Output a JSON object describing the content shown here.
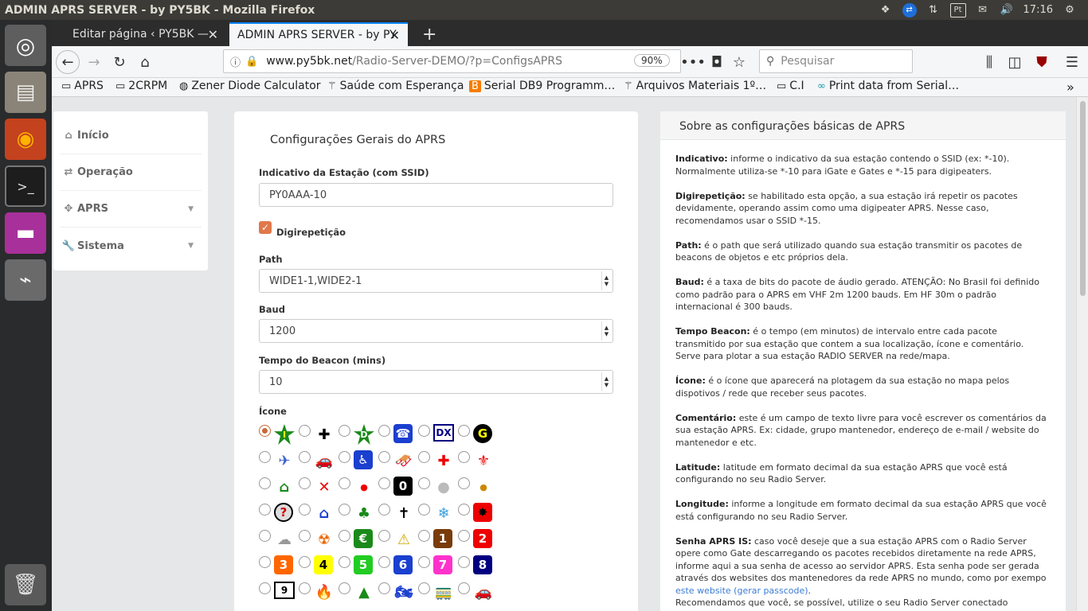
{
  "window": {
    "title": "ADMIN APRS SERVER - by PY5BK - Mozilla Firefox",
    "clock": "17:16",
    "tray_box_label": "Pt"
  },
  "tabs": [
    {
      "label": "Editar página ‹ PY5BK —",
      "close": "✕"
    },
    {
      "label": "ADMIN APRS SERVER - by PY",
      "close": "✕"
    }
  ],
  "new_tab": "+",
  "urlbar": {
    "domain": "www.py5bk.net",
    "path": "/Radio-Server-DEMO/?p=ConfigsAPRS",
    "zoom": "90%"
  },
  "search": {
    "placeholder": "Pesquisar"
  },
  "bookmarks": [
    {
      "icon": "folder-icon",
      "glyph": "▭",
      "label": "APRS"
    },
    {
      "icon": "folder-icon",
      "glyph": "▭",
      "label": "2CRPM"
    },
    {
      "icon": "globe-icon",
      "glyph": "◍",
      "label": "Zener Diode Calculator"
    },
    {
      "icon": "site-icon",
      "glyph": "⚚",
      "label": "Saúde com Esperança"
    },
    {
      "icon": "blogger-icon",
      "glyph": "B",
      "label": "Serial DB9 Programm…"
    },
    {
      "icon": "site-icon",
      "glyph": "⚚",
      "label": "Arquivos Materiais 1º…"
    },
    {
      "icon": "folder-icon",
      "glyph": "▭",
      "label": "C.I"
    },
    {
      "icon": "link-icon",
      "glyph": "∞",
      "label": "Print data from Serial…"
    }
  ],
  "sidebar": {
    "items": [
      {
        "icon": "home-icon",
        "glyph": "⌂",
        "label": "Início",
        "caret": ""
      },
      {
        "icon": "shuffle-icon",
        "glyph": "⇄",
        "label": "Operação",
        "caret": ""
      },
      {
        "icon": "crosshair-icon",
        "glyph": "✥",
        "label": "APRS",
        "caret": "▼"
      },
      {
        "icon": "wrench-icon",
        "glyph": "🔧",
        "label": "Sistema",
        "caret": "▼"
      }
    ]
  },
  "form": {
    "title": "Configurações Gerais do APRS",
    "callsign_label": "Indicativo da Estação (com SSID)",
    "callsign_value": "PY0AAA-10",
    "digi_label": "Digirepetição",
    "digi_checked": true,
    "path_label": "Path",
    "path_value": "WIDE1-1,WIDE2-1",
    "baud_label": "Baud",
    "baud_value": "1200",
    "beacon_label": "Tempo do Beacon (mins)",
    "beacon_value": "10",
    "icon_label": "Ícone",
    "icons": [
      {
        "name": "star-icon",
        "glyph": "I",
        "bg": "#1a8a1a",
        "fg": "#ff0",
        "shape": "star"
      },
      {
        "name": "crosshair-icon",
        "glyph": "✚",
        "bg": "",
        "fg": "#000",
        "shape": "plain"
      },
      {
        "name": "digi-star-icon",
        "glyph": "D",
        "bg": "#1a8a1a",
        "fg": "#fff",
        "shape": "star"
      },
      {
        "name": "phone-icon",
        "glyph": "☎",
        "bg": "#1b3fcf",
        "fg": "#fff",
        "shape": "square"
      },
      {
        "name": "dx-icon",
        "glyph": "DX",
        "bg": "#fff",
        "fg": "#000080",
        "shape": "box"
      },
      {
        "name": "gate-icon",
        "glyph": "G",
        "bg": "#000",
        "fg": "#ff0",
        "shape": "diamond"
      },
      {
        "name": "plane-icon",
        "glyph": "✈",
        "bg": "",
        "fg": "#3a5fcd",
        "shape": "plain"
      },
      {
        "name": "car-icon",
        "glyph": "🚗",
        "bg": "",
        "fg": "#b00",
        "shape": "plain"
      },
      {
        "name": "wheelchair-icon",
        "glyph": "♿",
        "bg": "#1b3fcf",
        "fg": "#fff",
        "shape": "square"
      },
      {
        "name": "snowmobile-icon",
        "glyph": "🛷",
        "bg": "",
        "fg": "#000",
        "shape": "plain"
      },
      {
        "name": "red-cross-icon",
        "glyph": "✚",
        "bg": "",
        "fg": "#e00",
        "shape": "plain"
      },
      {
        "name": "scout-icon",
        "glyph": "⚜",
        "bg": "",
        "fg": "#e00",
        "shape": "plain"
      },
      {
        "name": "house-icon",
        "glyph": "⌂",
        "bg": "",
        "fg": "#1a8a1a",
        "shape": "plain"
      },
      {
        "name": "x-icon",
        "glyph": "✕",
        "bg": "",
        "fg": "#e00",
        "shape": "plain"
      },
      {
        "name": "red-dot-icon",
        "glyph": "●",
        "bg": "",
        "fg": "#e00",
        "shape": "small"
      },
      {
        "name": "zero-icon",
        "glyph": "0",
        "bg": "#000",
        "fg": "#fff",
        "shape": "square"
      },
      {
        "name": "circle-icon",
        "glyph": "●",
        "bg": "",
        "fg": "#bbb",
        "shape": "plain"
      },
      {
        "name": "dot-icon",
        "glyph": "●",
        "bg": "",
        "fg": "#c80",
        "shape": "small"
      },
      {
        "name": "question-icon",
        "glyph": "?",
        "bg": "#ddd",
        "fg": "#c00",
        "shape": "circle"
      },
      {
        "name": "shelter-icon",
        "glyph": "⌂",
        "bg": "",
        "fg": "#1b3fcf",
        "shape": "plain"
      },
      {
        "name": "clover-icon",
        "glyph": "♣",
        "bg": "",
        "fg": "#1a8a1a",
        "shape": "plain"
      },
      {
        "name": "church-icon",
        "glyph": "✝",
        "bg": "",
        "fg": "#000",
        "shape": "plain"
      },
      {
        "name": "snowflake-icon",
        "glyph": "❄",
        "bg": "",
        "fg": "#3a9fdf",
        "shape": "plain"
      },
      {
        "name": "burst-icon",
        "glyph": "✸",
        "bg": "#e00",
        "fg": "#000",
        "shape": "square"
      },
      {
        "name": "cloud-icon",
        "glyph": "☁",
        "bg": "",
        "fg": "#999",
        "shape": "plain"
      },
      {
        "name": "hazard-icon",
        "glyph": "☢",
        "bg": "",
        "fg": "#e60",
        "shape": "plain"
      },
      {
        "name": "euro-icon",
        "glyph": "€",
        "bg": "#1a8a1a",
        "fg": "#fff",
        "shape": "square"
      },
      {
        "name": "warning-icon",
        "glyph": "⚠",
        "bg": "",
        "fg": "#ccaa00",
        "shape": "plain"
      },
      {
        "name": "one-icon",
        "glyph": "1",
        "bg": "#7a3b0a",
        "fg": "#fff",
        "shape": "square"
      },
      {
        "name": "two-icon",
        "glyph": "2",
        "bg": "#e00",
        "fg": "#fff",
        "shape": "square"
      },
      {
        "name": "three-icon",
        "glyph": "3",
        "bg": "#f60",
        "fg": "#fff",
        "shape": "square"
      },
      {
        "name": "four-icon",
        "glyph": "4",
        "bg": "#ff0",
        "fg": "#000",
        "shape": "square"
      },
      {
        "name": "five-icon",
        "glyph": "5",
        "bg": "#2c2",
        "fg": "#fff",
        "shape": "square"
      },
      {
        "name": "six-icon",
        "glyph": "6",
        "bg": "#1b3fcf",
        "fg": "#fff",
        "shape": "square"
      },
      {
        "name": "seven-icon",
        "glyph": "7",
        "bg": "#f3c",
        "fg": "#fff",
        "shape": "square"
      },
      {
        "name": "eight-icon",
        "glyph": "8",
        "bg": "#000080",
        "fg": "#fff",
        "shape": "square"
      },
      {
        "name": "nine-icon",
        "glyph": "9",
        "bg": "#fff",
        "fg": "#000",
        "shape": "box"
      },
      {
        "name": "fire-icon",
        "glyph": "🔥",
        "bg": "",
        "fg": "#e40",
        "shape": "plain"
      },
      {
        "name": "tent-icon",
        "glyph": "▲",
        "bg": "",
        "fg": "#1a8a1a",
        "shape": "plain"
      },
      {
        "name": "motorcycle-icon",
        "glyph": "🏍",
        "bg": "",
        "fg": "#1b3fcf",
        "shape": "plain"
      },
      {
        "name": "railroad-icon",
        "glyph": "🚃",
        "bg": "",
        "fg": "#c00",
        "shape": "plain"
      },
      {
        "name": "red-car-icon",
        "glyph": "🚗",
        "bg": "",
        "fg": "#c00",
        "shape": "plain"
      }
    ]
  },
  "info": {
    "heading": "Sobre as configurações básicas de APRS",
    "items": [
      {
        "term": "Indicativo:",
        "text": " informe o indicativo da sua estação contendo o SSID (ex: *-10). Normalmente utiliza-se *-10 para iGate e Gates e *-15 para digipeaters."
      },
      {
        "term": "Digirepetição:",
        "text": " se habilitado esta opção, a sua estação irá repetir os pacotes devidamente, operando assim como uma digipeater APRS. Nesse caso, recomendamos usar o SSID *-15."
      },
      {
        "term": "Path:",
        "text": " é o path que será utilizado quando sua estação transmitir os pacotes de beacons de objetos e etc próprios dela."
      },
      {
        "term": "Baud:",
        "text": " é a taxa de bits do pacote de áudio gerado. ATENÇÃO: No Brasil foi definido como padrão para o APRS em VHF 2m 1200 bauds. Em HF 30m o padrão internacional é 300 bauds."
      },
      {
        "term": "Tempo Beacon:",
        "text": " é o tempo (em minutos) de intervalo entre cada pacote transmitido por sua estação que contem a sua localização, ícone e comentário. Serve para plotar a sua estação RADIO SERVER na rede/mapa."
      },
      {
        "term": "Ícone:",
        "text": " é o ícone que aparecerá na plotagem da sua estação no mapa pelos dispotivos / rede que receber seus pacotes."
      },
      {
        "term": "Comentário:",
        "text": " este é um campo de texto livre para você escrever os comentários da sua estação APRS. Ex: cidade, grupo mantenedor, endereço de e-mail / website do mantenedor e etc."
      },
      {
        "term": "Latitude:",
        "text": " latitude em formato decimal da sua estação APRS que você está configurando no seu Radio Server."
      },
      {
        "term": "Longitude:",
        "text": " informe a longitude em formato decimal da sua estação APRS que você está configurando no seu Radio Server."
      }
    ],
    "senha_term": "Senha APRS IS:",
    "senha_text": " caso você deseje que a sua estação APRS com o Radio Server opere como Gate descarregando os pacotes recebidos diretamente na rede APRS, informe aqui a sua senha de acesso ao servidor APRS. Esta senha pode ser gerada através dos websites dos mantenedores da rede APRS no mundo, como por exempo ",
    "senha_link": "este website (gerar passcode)",
    "senha_end": ".",
    "recommend": "Recomendamos que você, se possível, utilize o seu Radio Server conectado diretamente a Internet e descarregando os pacotes diretamente na rede, sendo"
  }
}
